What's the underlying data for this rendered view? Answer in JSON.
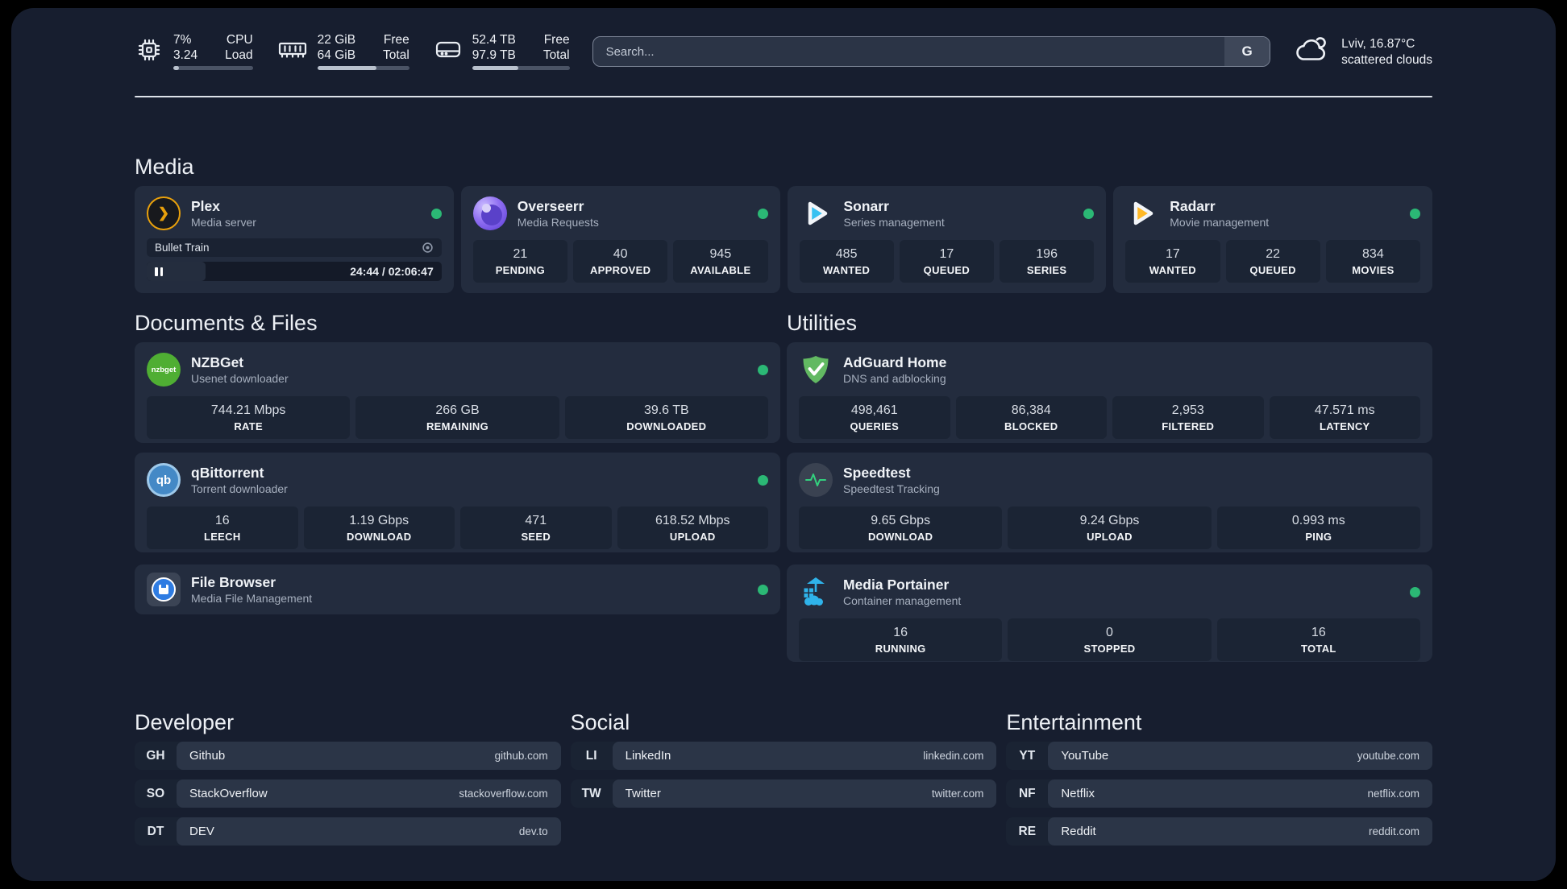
{
  "header": {
    "system_stats": [
      {
        "icon": "cpu-icon",
        "value_line1": "7%",
        "value_line2": "3.24",
        "label_line1": "CPU",
        "label_line2": "Load",
        "progress": 7
      },
      {
        "icon": "ram-icon",
        "value_line1": "22 GiB",
        "value_line2": "64 GiB",
        "label_line1": "Free",
        "label_line2": "Total",
        "progress": 64
      },
      {
        "icon": "disk-icon",
        "value_line1": "52.4 TB",
        "value_line2": "97.9 TB",
        "label_line1": "Free",
        "label_line2": "Total",
        "progress": 47
      }
    ],
    "search": {
      "placeholder": "Search...",
      "engine_button": "G"
    },
    "weather": {
      "location_temp": "Lviv, 16.87°C",
      "condition": "scattered clouds"
    }
  },
  "sections": {
    "media": {
      "title": "Media",
      "apps": [
        {
          "name": "Plex",
          "desc": "Media server",
          "online": true,
          "player": {
            "title": "Bullet Train",
            "time": "24:44 / 02:06:47",
            "progress": 20
          }
        },
        {
          "name": "Overseerr",
          "desc": "Media Requests",
          "online": true,
          "stats": [
            {
              "value": "21",
              "label": "PENDING"
            },
            {
              "value": "40",
              "label": "APPROVED"
            },
            {
              "value": "945",
              "label": "AVAILABLE"
            }
          ]
        },
        {
          "name": "Sonarr",
          "desc": "Series management",
          "online": true,
          "stats": [
            {
              "value": "485",
              "label": "WANTED"
            },
            {
              "value": "17",
              "label": "QUEUED"
            },
            {
              "value": "196",
              "label": "SERIES"
            }
          ]
        },
        {
          "name": "Radarr",
          "desc": "Movie management",
          "online": true,
          "stats": [
            {
              "value": "17",
              "label": "WANTED"
            },
            {
              "value": "22",
              "label": "QUEUED"
            },
            {
              "value": "834",
              "label": "MOVIES"
            }
          ]
        }
      ]
    },
    "documents": {
      "title": "Documents & Files",
      "apps": [
        {
          "name": "NZBGet",
          "desc": "Usenet downloader",
          "online": true,
          "stats": [
            {
              "value": "744.21 Mbps",
              "label": "RATE"
            },
            {
              "value": "266 GB",
              "label": "REMAINING"
            },
            {
              "value": "39.6 TB",
              "label": "DOWNLOADED"
            }
          ]
        },
        {
          "name": "qBittorrent",
          "desc": "Torrent downloader",
          "online": true,
          "stats": [
            {
              "value": "16",
              "label": "LEECH"
            },
            {
              "value": "1.19 Gbps",
              "label": "DOWNLOAD"
            },
            {
              "value": "471",
              "label": "SEED"
            },
            {
              "value": "618.52 Mbps",
              "label": "UPLOAD"
            }
          ]
        },
        {
          "name": "File Browser",
          "desc": "Media File Management",
          "online": true
        }
      ]
    },
    "utilities": {
      "title": "Utilities",
      "apps": [
        {
          "name": "AdGuard Home",
          "desc": "DNS and adblocking",
          "online": false,
          "stats": [
            {
              "value": "498,461",
              "label": "QUERIES"
            },
            {
              "value": "86,384",
              "label": "BLOCKED"
            },
            {
              "value": "2,953",
              "label": "FILTERED"
            },
            {
              "value": "47.571 ms",
              "label": "LATENCY"
            }
          ]
        },
        {
          "name": "Speedtest",
          "desc": "Speedtest Tracking",
          "online": false,
          "stats": [
            {
              "value": "9.65 Gbps",
              "label": "DOWNLOAD"
            },
            {
              "value": "9.24 Gbps",
              "label": "UPLOAD"
            },
            {
              "value": "0.993 ms",
              "label": "PING"
            }
          ]
        },
        {
          "name": "Media Portainer",
          "desc": "Container management",
          "online": true,
          "stats": [
            {
              "value": "16",
              "label": "RUNNING"
            },
            {
              "value": "0",
              "label": "STOPPED"
            },
            {
              "value": "16",
              "label": "TOTAL"
            }
          ]
        }
      ]
    },
    "links": [
      {
        "title": "Developer",
        "items": [
          {
            "abbr": "GH",
            "name": "Github",
            "url": "github.com"
          },
          {
            "abbr": "SO",
            "name": "StackOverflow",
            "url": "stackoverflow.com"
          },
          {
            "abbr": "DT",
            "name": "DEV",
            "url": "dev.to"
          }
        ]
      },
      {
        "title": "Social",
        "items": [
          {
            "abbr": "LI",
            "name": "LinkedIn",
            "url": "linkedin.com"
          },
          {
            "abbr": "TW",
            "name": "Twitter",
            "url": "twitter.com"
          }
        ]
      },
      {
        "title": "Entertainment",
        "items": [
          {
            "abbr": "YT",
            "name": "YouTube",
            "url": "youtube.com"
          },
          {
            "abbr": "NF",
            "name": "Netflix",
            "url": "netflix.com"
          },
          {
            "abbr": "RE",
            "name": "Reddit",
            "url": "reddit.com"
          }
        ]
      }
    ]
  },
  "colors": {
    "status_online": "#2bb875",
    "plex": "#e8a00c",
    "overseerr": "#7c5dfa",
    "sonarr": "#38c1f1",
    "radarr": "#ffb927",
    "nzbget": "#4fae33",
    "qbittorrent": "#4489c6",
    "filebrowser": "#2f7ce2",
    "adguard": "#62b962",
    "speedtest_pulse": "#33d17e",
    "portainer": "#2fb3ea",
    "page_bg": "#171e2f",
    "card_bg": "#232c3e",
    "stat_bg": "#1b2434"
  }
}
